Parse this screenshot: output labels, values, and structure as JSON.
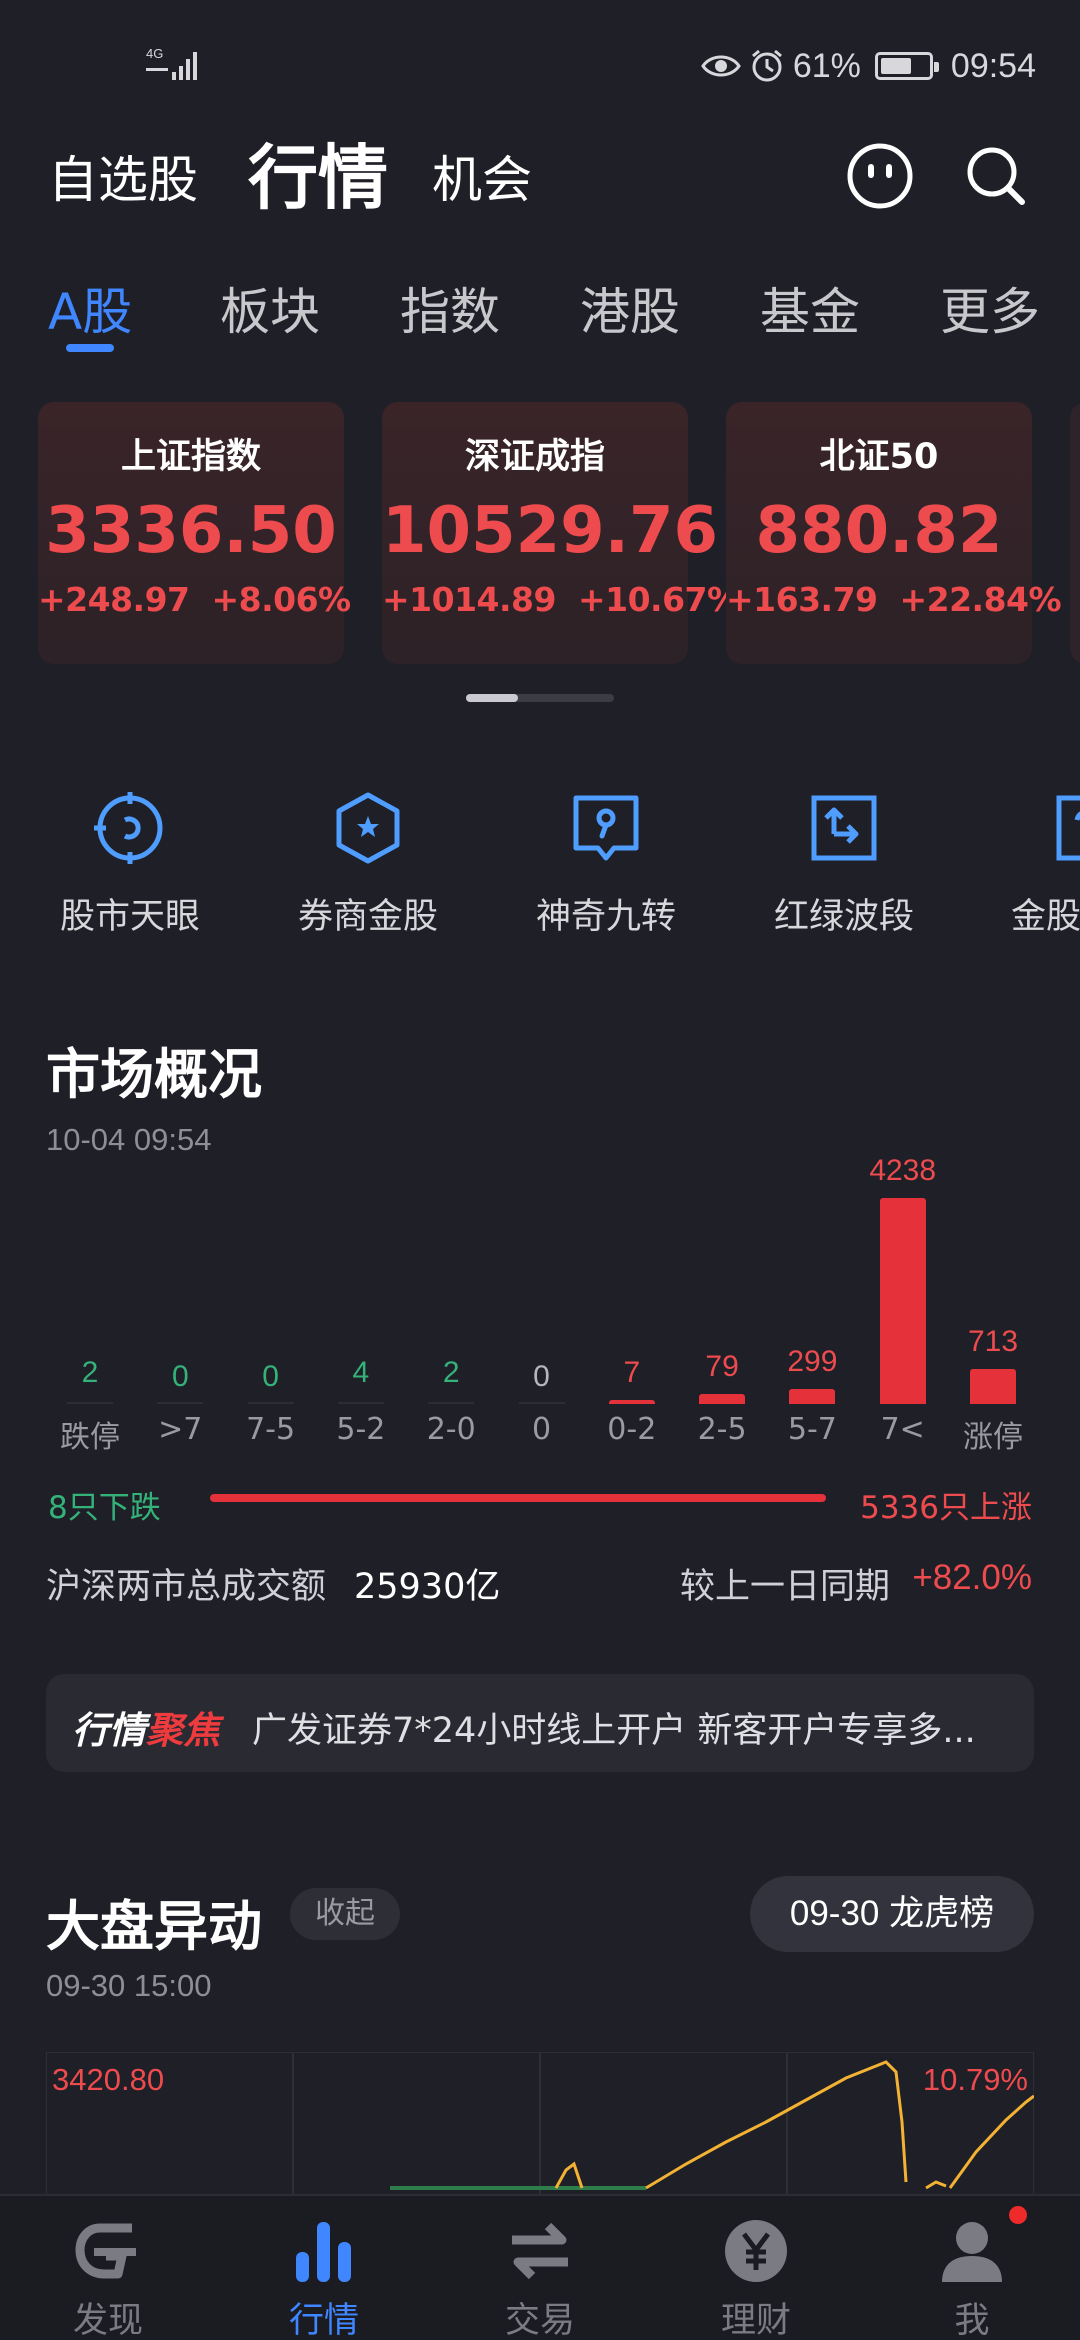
{
  "status_bar": {
    "network": "4G",
    "battery": "61%",
    "time": "09:54"
  },
  "header": {
    "tabs": [
      "自选股",
      "行情",
      "机会"
    ],
    "active_tab": "行情"
  },
  "market_tabs": {
    "items": [
      "A股",
      "板块",
      "指数",
      "港股",
      "基金",
      "更多"
    ],
    "active": "A股"
  },
  "index_cards": [
    {
      "name": "上证指数",
      "value": "3336.50",
      "change": "+248.97",
      "pct": "+8.06%"
    },
    {
      "name": "深证成指",
      "value": "10529.76",
      "change": "+1014.89",
      "pct": "+10.67%"
    },
    {
      "name": "北证50",
      "value": "880.82",
      "change": "+163.79",
      "pct": "+22.84%"
    }
  ],
  "tools": [
    {
      "label": "股市天眼",
      "icon": "radar-icon"
    },
    {
      "label": "券商金股",
      "icon": "star-hexagon-icon"
    },
    {
      "label": "神奇九转",
      "icon": "map-pin-board-icon"
    },
    {
      "label": "红绿波段",
      "icon": "swap-arrows-icon"
    },
    {
      "label": "金股",
      "icon": "partial-tool-icon"
    }
  ],
  "market_overview": {
    "title": "市场概况",
    "timestamp": "10-04 09:54",
    "down_summary": "8只下跌",
    "up_summary": "5336只上涨",
    "turnover_label": "沪深两市总成交额",
    "turnover_value": "25930亿",
    "compare_label": "较上一日同期",
    "compare_value": "+82.0%"
  },
  "chart_data": {
    "type": "bar",
    "categories": [
      "跌停",
      ">7",
      "7-5",
      "5-2",
      "2-0",
      "0",
      "0-2",
      "2-5",
      "5-7",
      "7<",
      "涨停"
    ],
    "values": [
      2,
      0,
      0,
      4,
      2,
      0,
      7,
      79,
      299,
      4238,
      713
    ],
    "colors": [
      "#34b27a",
      "#34b27a",
      "#34b27a",
      "#34b27a",
      "#34b27a",
      "#b5b5bb",
      "#ee4b4e",
      "#ee4b4e",
      "#ee4b4e",
      "#ee4b4e",
      "#ee4b4e"
    ]
  },
  "focus": {
    "tag_part1": "行情",
    "tag_part2": "聚焦",
    "text": "广发证券7*24小时线上开户 新客开户专享多..."
  },
  "market_move": {
    "title": "大盘异动",
    "collapse_label": "收起",
    "timestamp": "09-30 15:00",
    "dragon_tiger_label": "09-30 龙虎榜",
    "high_value": "3420.80",
    "high_pct": "10.79%"
  },
  "bottom_nav": {
    "items": [
      {
        "label": "发现",
        "icon": "discover-logo-icon"
      },
      {
        "label": "行情",
        "icon": "bar-chart-icon"
      },
      {
        "label": "交易",
        "icon": "exchange-arrows-icon"
      },
      {
        "label": "理财",
        "icon": "yuan-coin-icon"
      },
      {
        "label": "我",
        "icon": "person-icon"
      }
    ],
    "active": "行情"
  },
  "colors": {
    "background": "#1f1f27",
    "accent": "#3f86ff",
    "up": "#ee4b4e",
    "down": "#34b27a"
  }
}
